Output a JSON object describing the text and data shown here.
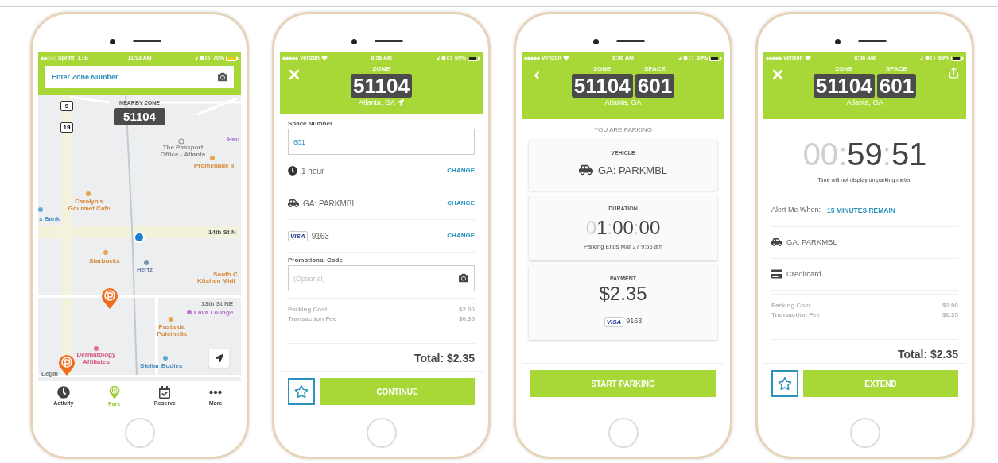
{
  "phones": [
    {
      "kind": "map",
      "status": {
        "carrier": "Sprint",
        "network": "LTE",
        "time": "11:03 AM",
        "battery": "70%"
      },
      "search": {
        "placeholder": "Enter Zone Number"
      },
      "map": {
        "nearby_label": "NEARBY ZONE",
        "nearby_zone": "51104",
        "shields": [
          "9",
          "19"
        ],
        "labels": [
          {
            "text": "Hau",
            "color": "#b06cc8"
          },
          {
            "text": "The Passport Office - Atlanta",
            "color": "#8c8c8c"
          },
          {
            "text": "Promenade II",
            "color": "#d9893a"
          },
          {
            "text": "Carolyn's Gourmet Cafe",
            "color": "#d9893a"
          },
          {
            "text": "s Bank",
            "color": "#4a8fc2"
          },
          {
            "text": "14th St N",
            "color": "#555555"
          },
          {
            "text": "Starbucks",
            "color": "#d9893a"
          },
          {
            "text": "Hertz",
            "color": "#6b7fa8"
          },
          {
            "text": "South C",
            "color": "#d9893a"
          },
          {
            "text": "Kitchen Midt",
            "color": "#d9893a"
          },
          {
            "text": "13th St NE",
            "color": "#777777"
          },
          {
            "text": "Lava Lounge",
            "color": "#b06cc8"
          },
          {
            "text": "Pasta da Pulcinella",
            "color": "#d9893a"
          },
          {
            "text": "Dermatology Affiliates",
            "color": "#d9577a"
          },
          {
            "text": "Stellar Bodies",
            "color": "#4a8fc2"
          },
          {
            "text": "Legal",
            "color": "#777777"
          }
        ]
      },
      "tabs": [
        {
          "label": "Activity",
          "selected": false
        },
        {
          "label": "Park",
          "selected": true
        },
        {
          "label": "Reserve",
          "selected": false
        },
        {
          "label": "More",
          "selected": false
        }
      ]
    },
    {
      "kind": "form",
      "status": {
        "carrier": "Verizon",
        "time": "8:56 AM",
        "battery": "69%"
      },
      "header": {
        "left": {
          "kind": "close"
        },
        "location_arrow": true,
        "codes": [
          {
            "label": "ZONE",
            "value": "51104"
          }
        ],
        "location": "Atlanta, GA"
      },
      "space": {
        "label": "Space Number",
        "value": "601"
      },
      "rows": [
        {
          "kind": "duration",
          "text": "1 hour",
          "action": "CHANGE"
        },
        {
          "kind": "vehicle",
          "text": "GA: PARKMBL",
          "action": "CHANGE"
        },
        {
          "kind": "card",
          "brand": "VISA",
          "text": "9163",
          "action": "CHANGE"
        }
      ],
      "promo": {
        "label": "Promotional Code",
        "placeholder": "(Optional)"
      },
      "costs": [
        {
          "label": "Parking Cost",
          "amount": "$2.00"
        },
        {
          "label": "Transaction Fee",
          "amount": "$0.35"
        }
      ],
      "total": "Total: $2.35",
      "button": "CONTINUE"
    },
    {
      "kind": "confirm",
      "status": {
        "carrier": "Verizon",
        "time": "8:56 AM",
        "battery": "69%"
      },
      "header": {
        "left": {
          "kind": "back"
        },
        "codes": [
          {
            "label": "ZONE",
            "value": "51104"
          },
          {
            "label": "SPACE",
            "value": "601"
          }
        ],
        "location": "Atlanta, GA"
      },
      "heading": "YOU ARE PARKING",
      "vehicle": {
        "title": "VEHICLE",
        "text": "GA: PARKMBL"
      },
      "duration": {
        "title": "DURATION",
        "timer": [
          {
            "text": "0",
            "dim": true
          },
          {
            "text": "1",
            "dim": false
          },
          {
            "text": ":",
            "dim": true
          },
          {
            "text": "00",
            "dim": false
          },
          {
            "text": ":",
            "dim": true
          },
          {
            "text": "00",
            "dim": false
          }
        ],
        "note": "Parking Ends Mar 27 9:56 am"
      },
      "payment": {
        "title": "PAYMENT",
        "amount": "$2.35",
        "brand": "VISA",
        "card": "9163"
      },
      "button": "START PARKING"
    },
    {
      "kind": "session",
      "status": {
        "carrier": "Verizon",
        "time": "8:56 AM",
        "battery": "69%"
      },
      "header": {
        "left": {
          "kind": "close"
        },
        "right": {
          "kind": "share"
        },
        "codes": [
          {
            "label": "ZONE",
            "value": "51104"
          },
          {
            "label": "SPACE",
            "value": "601"
          }
        ],
        "location": "Atlanta, GA"
      },
      "timer": [
        {
          "text": "00",
          "dim": true
        },
        {
          "text": ":",
          "dim": true
        },
        {
          "text": "59",
          "dim": false
        },
        {
          "text": ":",
          "dim": true
        },
        {
          "text": "51",
          "dim": false
        }
      ],
      "note": "Time will not display on parking meter.",
      "alert": {
        "label": "Alert Me When:",
        "value": "15 MINUTES REMAIN"
      },
      "rows": [
        {
          "kind": "vehicle",
          "text": "GA: PARKMBL"
        },
        {
          "kind": "creditcard",
          "text": "Creditcard"
        }
      ],
      "costs": [
        {
          "label": "Parking Cost",
          "amount": "$2.00"
        },
        {
          "label": "Transaction Fee",
          "amount": "$0.35"
        }
      ],
      "total": "Total: $2.35",
      "button": "EXTEND"
    }
  ]
}
